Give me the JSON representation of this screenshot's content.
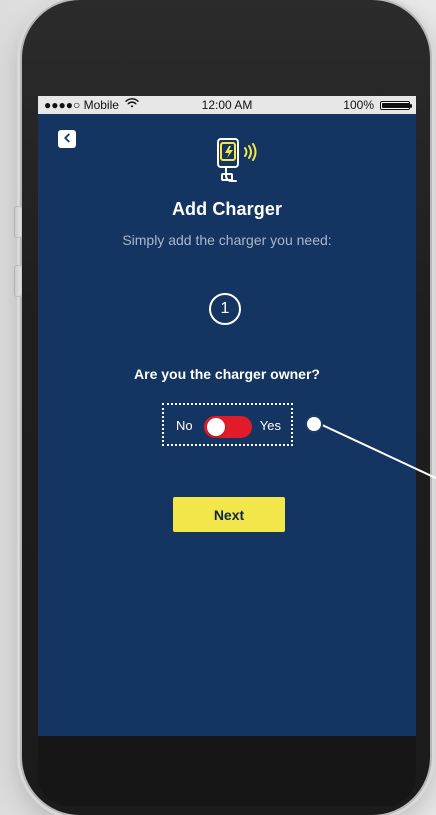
{
  "statusbar": {
    "carrier": "●●●●○ Mobile",
    "time": "12:00 AM",
    "battery_percent_text": "100%",
    "battery_level": 1.0
  },
  "screen": {
    "title": "Add Charger",
    "subtitle": "Simply add the charger you need:",
    "step_number": "1",
    "question": "Are you the charger owner?",
    "toggle": {
      "left_label": "No",
      "right_label": "Yes",
      "state": "off"
    },
    "next_label": "Next"
  },
  "icons": {
    "back": "chevron-left-icon",
    "wifi": "wifi-icon",
    "charger": "wireless-charger-icon"
  },
  "colors": {
    "screen_bg": "#143461",
    "button_yellow": "#f2e64a",
    "toggle_red": "#e21b2b",
    "text_light": "#ffffff",
    "subtitle": "#a9b7cc"
  }
}
